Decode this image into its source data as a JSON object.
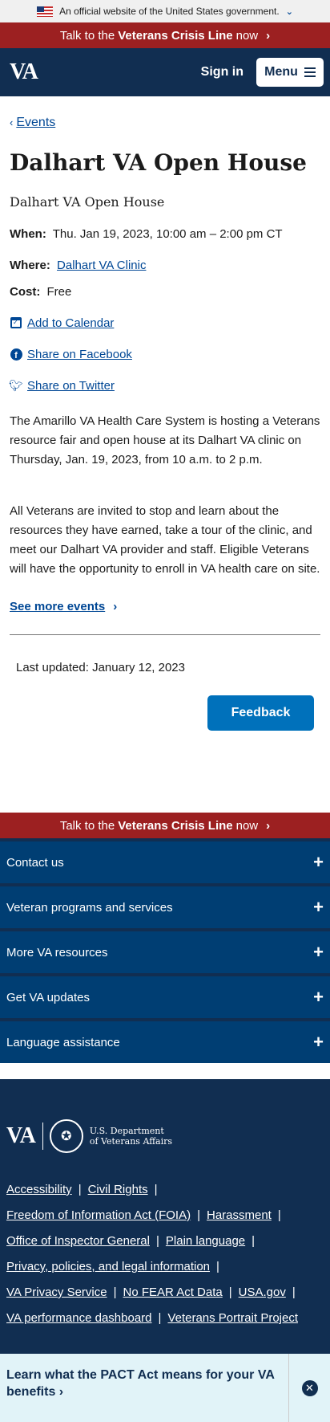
{
  "gov_banner": {
    "text": "An official website of the United States government."
  },
  "crisis_line": {
    "prefix": "Talk to the",
    "bold": "Veterans Crisis Line",
    "suffix": "now"
  },
  "header": {
    "logo": "VA",
    "sign_in": "Sign in",
    "menu": "Menu"
  },
  "breadcrumb": {
    "label": "Events"
  },
  "event": {
    "title": "Dalhart VA Open House",
    "subtitle": "Dalhart VA Open House",
    "when_label": "When:",
    "when_value": "Thu. Jan 19, 2023, 10:00 am – 2:00 pm CT",
    "where_label": "Where:",
    "where_value": "Dalhart VA Clinic",
    "cost_label": "Cost:",
    "cost_value": "Free",
    "add_calendar": "Add to Calendar",
    "share_facebook": "Share on Facebook",
    "share_twitter": "Share on Twitter",
    "para1": "The Amarillo VA Health Care System is hosting a Veterans resource fair and open house at its Dalhart VA clinic on Thursday, Jan. 19, 2023, from 10 a.m. to 2 p.m.",
    "para2": "All Veterans are invited to stop and learn about the resources they have earned, take a tour of the clinic, and meet our Dalhart VA provider and staff.  Eligible Veterans will have the opportunity to enroll in VA health care on site.",
    "see_more": "See more events"
  },
  "last_updated": "Last updated: January 12, 2023",
  "feedback": "Feedback",
  "footer": {
    "accordion": [
      "Contact us",
      "Veteran programs and services",
      "More VA resources",
      "Get VA updates",
      "Language assistance"
    ],
    "logo": "VA",
    "dept_line1": "U.S. Department",
    "dept_line2": "of Veterans Affairs",
    "links": [
      "Accessibility",
      "Civil Rights",
      "Freedom of Information Act (FOIA)",
      "Harassment",
      "Office of Inspector General",
      "Plain language",
      "Privacy, policies, and legal information",
      "VA Privacy Service",
      "No FEAR Act Data",
      "USA.gov",
      "VA performance dashboard",
      "Veterans Portrait Project"
    ]
  },
  "pact_banner": {
    "text": "Learn what the PACT Act means for your VA benefits"
  },
  "colors": {
    "navy": "#112e51",
    "crisis_red": "#9c2021",
    "link_blue": "#004795",
    "button_blue": "#0071bb"
  }
}
